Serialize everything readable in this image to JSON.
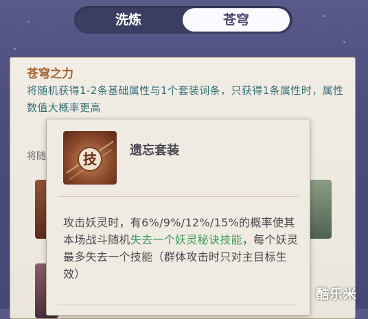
{
  "tabs": [
    {
      "label": "洗炼",
      "active": false
    },
    {
      "label": "苍穹",
      "active": true
    }
  ],
  "panel": {
    "title": "苍穹之力",
    "description": "将随机获得1-2条基础属性与1个套装词条，只获得1条属性时，属性数值大概率更高",
    "section_label": "将随"
  },
  "popup": {
    "icon_glyph": "技",
    "title": "遗忘套装",
    "desc_part1": "攻击妖灵时，有6%/9%/12%/15%的概率使其本场战斗随机",
    "desc_highlight": "失去一个妖灵秘诀技能",
    "desc_part2": "，每个妖灵最多失去一个技能（群体攻击时只对主目标生效）"
  },
  "colors": {
    "highlight": "#3b9b5b",
    "title_orange": "#a5622f",
    "desc_teal": "#356f78"
  },
  "watermark": "酷乐米"
}
